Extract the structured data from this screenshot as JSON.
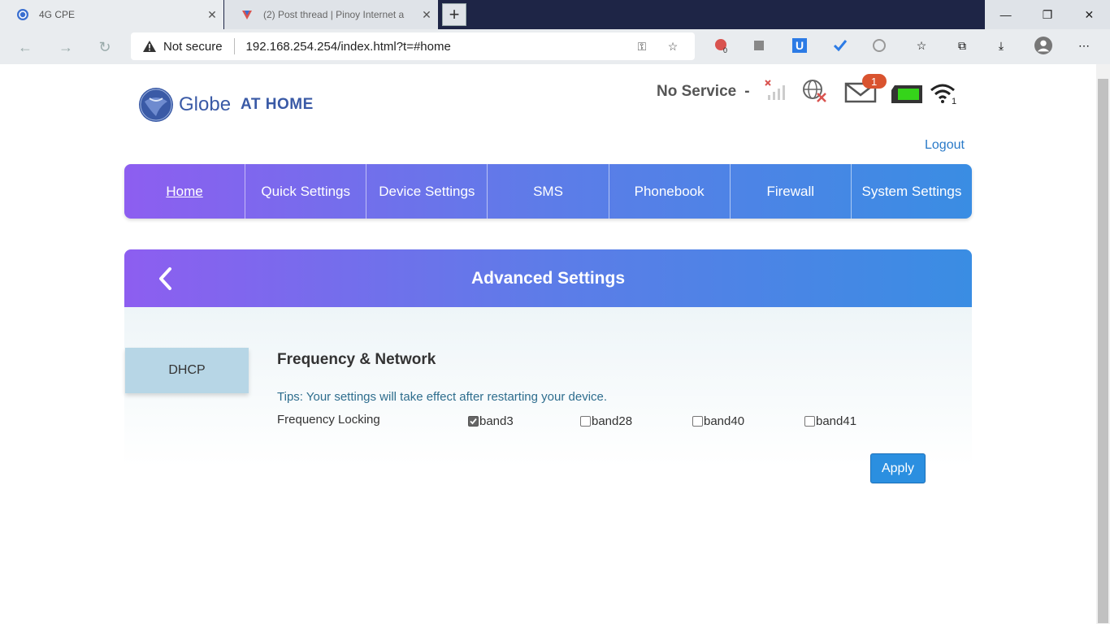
{
  "browser": {
    "tabs": [
      {
        "title": "4G CPE",
        "active": true
      },
      {
        "title": "(2) Post thread | Pinoy Internet a",
        "active": false
      }
    ],
    "new_tab_symbol": "+",
    "close_symbol": "✕",
    "omnibox": {
      "security_label": "Not secure",
      "url": "192.168.254.254/index.html?t=#home"
    },
    "extension_badge": "0"
  },
  "header": {
    "logo_text": "Globe",
    "logo_suffix": "AT HOME",
    "service_status": "No Service",
    "service_dash": "-",
    "sms_count": "1",
    "wifi_count": "1"
  },
  "logout_label": "Logout",
  "nav": {
    "items": [
      "Home",
      "Quick Settings",
      "Device Settings",
      "SMS",
      "Phonebook",
      "Firewall",
      "System Settings"
    ],
    "current": "Home"
  },
  "advanced": {
    "title": "Advanced Settings",
    "side_menu": [
      "DHCP"
    ],
    "section_title": "Frequency & Network",
    "tips": "Tips: Your settings will take effect after restarting your device.",
    "frequency_label": "Frequency Locking",
    "bands": [
      {
        "label": "band3",
        "checked": true
      },
      {
        "label": "band28",
        "checked": false
      },
      {
        "label": "band40",
        "checked": false
      },
      {
        "label": "band41",
        "checked": false
      }
    ],
    "apply_label": "Apply"
  },
  "colors": {
    "nav_gradient_start": "#8d5ef0",
    "nav_gradient_end": "#3a8de3",
    "apply_button": "#2b8fe0",
    "link": "#2a7ac8",
    "side_menu_bg": "#b7d6e6",
    "tab_strip": "#1e2546"
  }
}
